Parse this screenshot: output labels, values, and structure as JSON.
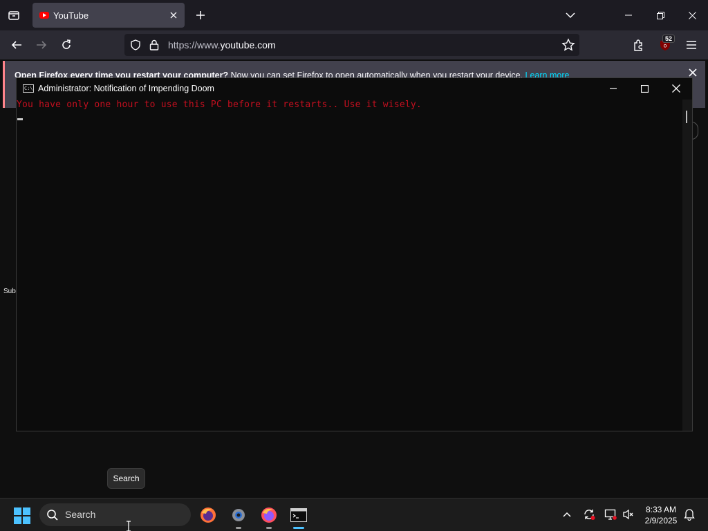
{
  "browser": {
    "tab_title": "YouTube",
    "url_domain_prefix": "https://www.",
    "url_domain": "youtube.com",
    "extension_badge": "52"
  },
  "notification": {
    "bold_text": "Open Firefox every time you restart your computer?",
    "text": " Now you can set Firefox to open automatically when you restart your device.",
    "link": "Learn more"
  },
  "youtube_sidebar_fragment": {
    "label": "Sub"
  },
  "console": {
    "title": "Administrator:  Notification of Impending Doom",
    "icon_text": "C:\\",
    "output_line": "You have only one hour to use this PC before it restarts.. Use it wisely."
  },
  "tooltip": {
    "text": "Search"
  },
  "taskbar": {
    "search_label": "Search",
    "time": "8:33 AM",
    "date": "2/9/2025"
  },
  "colors": {
    "console_text": "#c50f1f",
    "windows_accent": "#4cc2ff",
    "firefox_link": "#00ddff"
  }
}
